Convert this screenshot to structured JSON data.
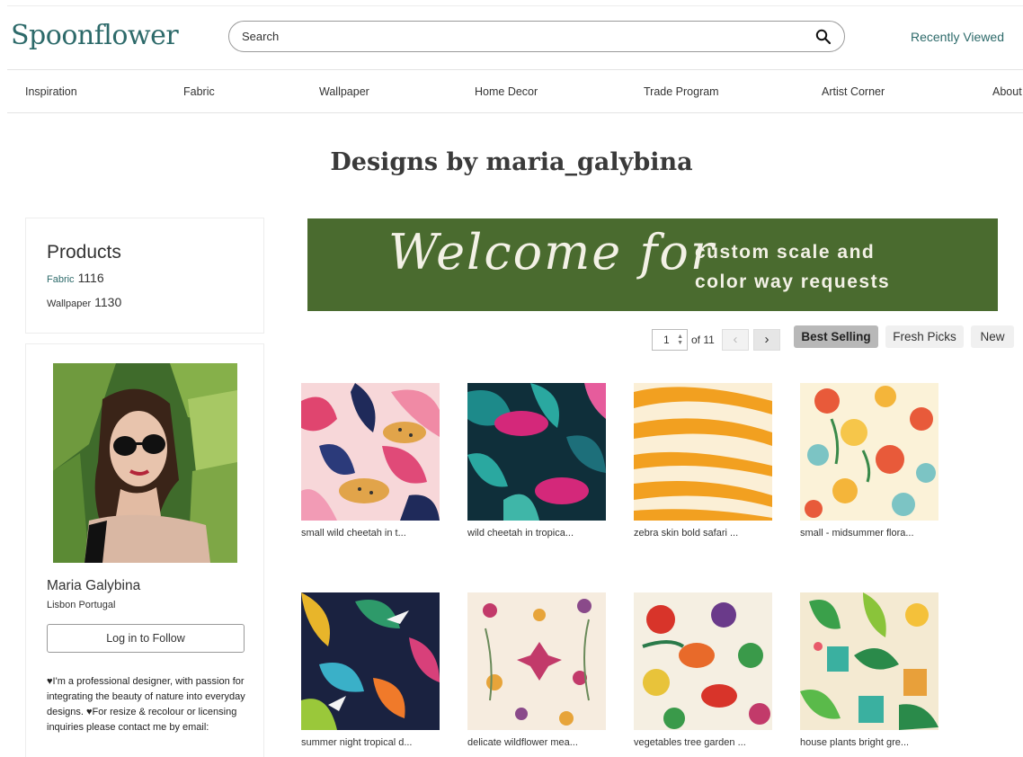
{
  "header": {
    "logo": "Spoonflower",
    "search_placeholder": "Search",
    "recently_viewed": "Recently Viewed"
  },
  "nav": [
    "Inspiration",
    "Fabric",
    "Wallpaper",
    "Home Decor",
    "Trade Program",
    "Artist Corner",
    "About"
  ],
  "page_title": "Designs by maria_galybina",
  "products": {
    "title": "Products",
    "items": [
      {
        "label": "Fabric",
        "count": "1116"
      },
      {
        "label": "Wallpaper",
        "count": "1130"
      }
    ]
  },
  "profile": {
    "name": "Maria Galybina",
    "location": "Lisbon Portugal",
    "follow_label": "Log in to Follow",
    "bio": "♥I'm a professional designer, with passion for integrating the beauty of nature into everyday designs. ♥For resize & recolour or licensing inquiries please contact me by email:"
  },
  "banner": {
    "script": "Welcome for",
    "line1": "custom scale and",
    "line2": "color way requests"
  },
  "pager": {
    "page": "1",
    "of_text": "of 11",
    "prev": "‹",
    "next": "›"
  },
  "sort": {
    "best_selling": "Best Selling",
    "fresh_picks": "Fresh Picks",
    "new": "New"
  },
  "designs": [
    {
      "title": "small wild cheetah in t...",
      "pattern": "cheetah-pink"
    },
    {
      "title": "wild cheetah in tropica...",
      "pattern": "cheetah-teal"
    },
    {
      "title": "zebra skin bold safari ...",
      "pattern": "zebra"
    },
    {
      "title": "small - midsummer flora...",
      "pattern": "floral"
    },
    {
      "title": "summer night tropical d...",
      "pattern": "tropical-night"
    },
    {
      "title": "delicate wildflower mea...",
      "pattern": "wildflower"
    },
    {
      "title": "vegetables tree garden ...",
      "pattern": "vegetables"
    },
    {
      "title": "house plants bright gre...",
      "pattern": "houseplants"
    }
  ]
}
